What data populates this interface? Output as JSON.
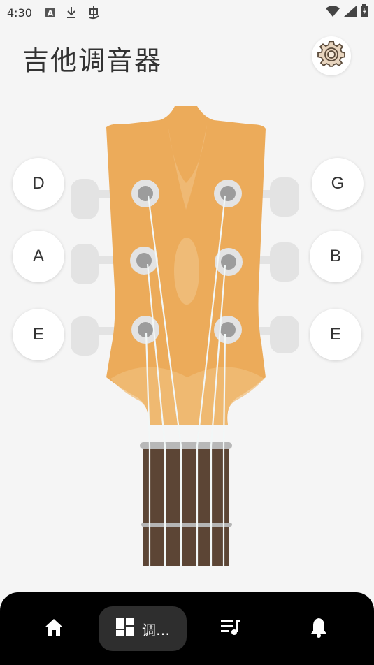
{
  "status_bar": {
    "time": "4:30",
    "icons": [
      "a-badge-icon",
      "download-icon",
      "bug-icon"
    ],
    "right_icons": [
      "wifi-icon",
      "signal-icon",
      "battery-icon"
    ]
  },
  "header": {
    "title": "吉他调音器",
    "settings_icon": "gear-icon"
  },
  "strings": {
    "left": [
      "D",
      "A",
      "E"
    ],
    "right": [
      "G",
      "B",
      "E"
    ]
  },
  "colors": {
    "headstock": "#ecab5a",
    "fretboard": "#5c4535",
    "peg": "#e3e3e3",
    "nav_bg": "#000000",
    "nav_active": "#2e2e2e"
  },
  "bottom_nav": {
    "items": [
      {
        "icon": "home-icon",
        "label": ""
      },
      {
        "icon": "tuner-icon",
        "label": "调…"
      },
      {
        "icon": "playlist-icon",
        "label": ""
      },
      {
        "icon": "bell-icon",
        "label": ""
      }
    ],
    "active_index": 1
  }
}
